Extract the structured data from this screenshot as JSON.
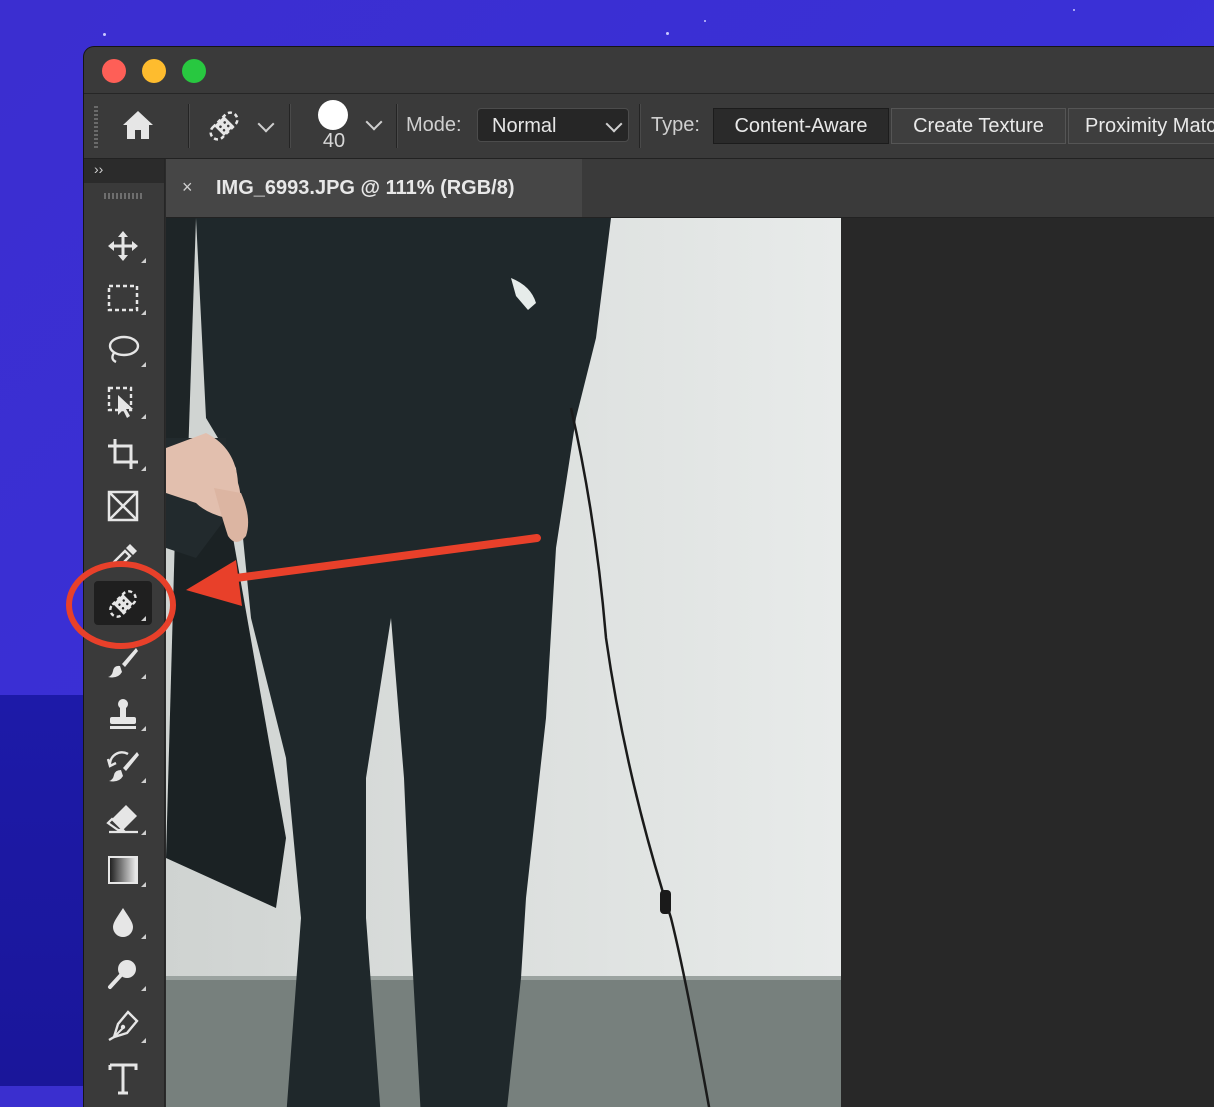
{
  "window": {
    "traffic_lights": [
      "close",
      "minimize",
      "maximize"
    ]
  },
  "options_bar": {
    "home_icon": "home-icon",
    "tool_icon": "bandage-icon",
    "brush_size": "40",
    "mode_label": "Mode:",
    "mode_value": "Normal",
    "type_label": "Type:",
    "type_options": [
      "Content-Aware",
      "Create Texture",
      "Proximity Match"
    ],
    "type_selected": "Content-Aware"
  },
  "toolbar": {
    "collapse_glyph": "››",
    "tools": [
      {
        "name": "move-tool",
        "icon": "move-icon"
      },
      {
        "name": "rectangular-marquee-tool",
        "icon": "marquee-icon"
      },
      {
        "name": "lasso-tool",
        "icon": "lasso-icon"
      },
      {
        "name": "object-selection-tool",
        "icon": "object-selection-icon"
      },
      {
        "name": "crop-tool",
        "icon": "crop-icon"
      },
      {
        "name": "frame-tool",
        "icon": "frame-icon"
      },
      {
        "name": "eyedropper-tool",
        "icon": "eyedropper-icon"
      },
      {
        "name": "spot-healing-brush-tool",
        "icon": "bandage-icon",
        "selected": true
      },
      {
        "name": "brush-tool",
        "icon": "brush-icon"
      },
      {
        "name": "clone-stamp-tool",
        "icon": "stamp-icon"
      },
      {
        "name": "history-brush-tool",
        "icon": "history-brush-icon"
      },
      {
        "name": "eraser-tool",
        "icon": "eraser-icon"
      },
      {
        "name": "gradient-tool",
        "icon": "gradient-icon"
      },
      {
        "name": "blur-tool",
        "icon": "drop-icon"
      },
      {
        "name": "dodge-tool",
        "icon": "dodge-icon"
      },
      {
        "name": "pen-tool",
        "icon": "pen-icon"
      },
      {
        "name": "type-tool",
        "icon": "type-icon"
      }
    ]
  },
  "document": {
    "close_glyph": "×",
    "tab_title": "IMG_6993.JPG @ 111% (RGB/8)"
  },
  "annotation": {
    "color": "#e8402a"
  },
  "colors": {
    "desktop": "#3b2ed0",
    "app_bg": "#3a3a3a",
    "canvas_bg": "#282828"
  }
}
